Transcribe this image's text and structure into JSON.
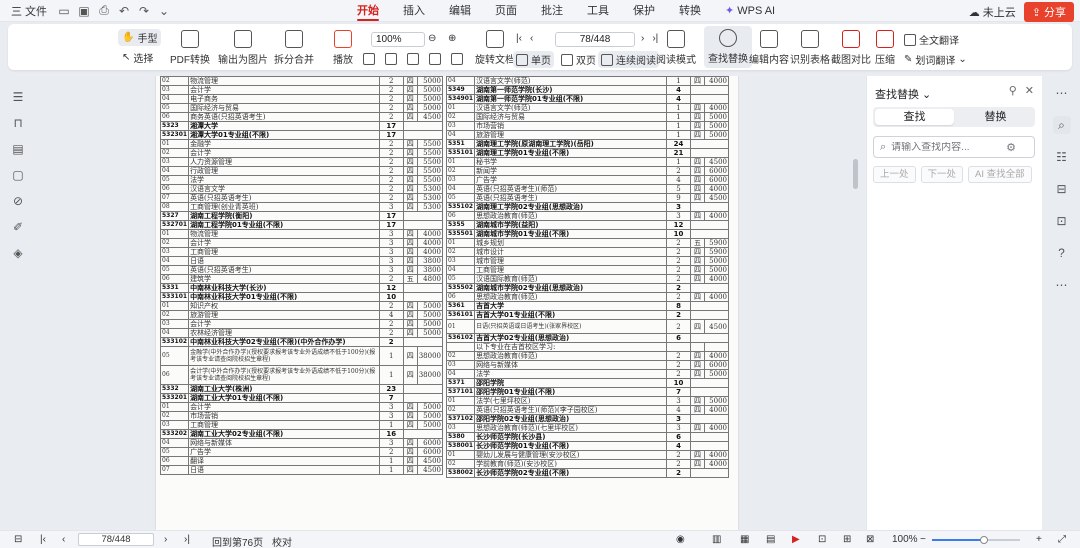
{
  "menubar": {
    "file_label": "三 文件",
    "tabs": [
      "开始",
      "插入",
      "编辑",
      "页面",
      "批注",
      "工具",
      "保护",
      "转换"
    ],
    "active_tab": "开始",
    "wps_ai": "WPS AI",
    "cloud": "未上云",
    "share": "分享"
  },
  "ribbon": {
    "hand": "手型",
    "select": "选择",
    "pdf_convert": "PDF转换",
    "export_image": "输出为图片",
    "split_merge": "拆分合并",
    "play": "播放",
    "zoom": "100%",
    "page": "78/448",
    "rotate": "旋转文档",
    "single": "单页",
    "double": "双页",
    "continuous": "连续阅读",
    "reading_mode": "阅读模式",
    "find_replace": "查找替换",
    "edit_content": "编辑内容",
    "recognize_table": "识别表格",
    "screenshot_compare": "截图对比",
    "compress": "压缩",
    "full_translate": "全文翻译",
    "word_translate": "划词翻译"
  },
  "panel": {
    "title": "查找替换",
    "tab_find": "查找",
    "tab_replace": "替换",
    "placeholder": "请输入查找内容...",
    "prev": "上一处",
    "next": "下一处",
    "ai_find": "AI 查找全部"
  },
  "status": {
    "page": "78/448",
    "goto": "回到第76页",
    "proofread": "校对",
    "zoom": "100%"
  },
  "doc": {
    "left": [
      {
        "c": "02",
        "n": "物流管理",
        "y": "2",
        "s": "四",
        "f": "5000"
      },
      {
        "c": "03",
        "n": "会计学",
        "y": "2",
        "s": "四",
        "f": "5000"
      },
      {
        "c": "04",
        "n": "电子商务",
        "y": "2",
        "s": "四",
        "f": "5000"
      },
      {
        "c": "05",
        "n": "国际经济与贸易",
        "y": "2",
        "s": "四",
        "f": "5000"
      },
      {
        "c": "06",
        "n": "商务英语(只招英语考生)",
        "y": "2",
        "s": "四",
        "f": "4500"
      },
      {
        "b": true,
        "c": "5323",
        "n": "湘潭大学",
        "y": "17"
      },
      {
        "b": true,
        "c": "532301",
        "n": "湘潭大学01专业组(不限)",
        "y": "17"
      },
      {
        "c": "01",
        "n": "金融学",
        "y": "2",
        "s": "四",
        "f": "5500"
      },
      {
        "c": "02",
        "n": "会计学",
        "y": "2",
        "s": "四",
        "f": "5500"
      },
      {
        "c": "03",
        "n": "人力资源管理",
        "y": "2",
        "s": "四",
        "f": "5500"
      },
      {
        "c": "04",
        "n": "行政管理",
        "y": "2",
        "s": "四",
        "f": "5500"
      },
      {
        "c": "05",
        "n": "法学",
        "y": "2",
        "s": "四",
        "f": "5500"
      },
      {
        "c": "06",
        "n": "汉语言文学",
        "y": "2",
        "s": "四",
        "f": "5300"
      },
      {
        "c": "07",
        "n": "英语(只招英语考生)",
        "y": "2",
        "s": "四",
        "f": "5300"
      },
      {
        "c": "08",
        "n": "工商管理(创业青英班)",
        "y": "3",
        "s": "四",
        "f": "5300"
      },
      {
        "b": true,
        "c": "5327",
        "n": "湖南工程学院(衡阳)",
        "y": "17"
      },
      {
        "b": true,
        "c": "532701",
        "n": "湖南工程学院01专业组(不限)",
        "y": "17"
      },
      {
        "c": "01",
        "n": "物流管理",
        "y": "3",
        "s": "四",
        "f": "4000"
      },
      {
        "c": "02",
        "n": "会计学",
        "y": "3",
        "s": "四",
        "f": "4000"
      },
      {
        "c": "03",
        "n": "工商管理",
        "y": "3",
        "s": "四",
        "f": "4000"
      },
      {
        "c": "04",
        "n": "日语",
        "y": "3",
        "s": "四",
        "f": "3800"
      },
      {
        "c": "05",
        "n": "英语(只招英语考生)",
        "y": "3",
        "s": "四",
        "f": "3800"
      },
      {
        "c": "06",
        "n": "建筑学",
        "y": "2",
        "s": "五",
        "f": "4800"
      },
      {
        "b": true,
        "c": "5331",
        "n": "中南林业科技大学(长沙)",
        "y": "12"
      },
      {
        "b": true,
        "c": "533101",
        "n": "中南林业科技大学01专业组(不限)",
        "y": "10"
      },
      {
        "c": "01",
        "n": "知识产权",
        "y": "2",
        "s": "四",
        "f": "5000"
      },
      {
        "c": "02",
        "n": "旅游管理",
        "y": "4",
        "s": "四",
        "f": "5000"
      },
      {
        "c": "03",
        "n": "会计学",
        "y": "2",
        "s": "四",
        "f": "5000"
      },
      {
        "c": "04",
        "n": "农林经济管理",
        "y": "2",
        "s": "四",
        "f": "5000"
      },
      {
        "b": true,
        "c": "533102",
        "n": "中南林业科技大学02专业组(不限)(中外合作办学)",
        "y": "2"
      },
      {
        "t": "tall",
        "c": "05",
        "n": "金融学(中外合作办学)(授权要求报考该专业外语成绩不低于100分)(报考该专业请查阅院校招生章程)",
        "y": "1",
        "s": "四",
        "f": "38000"
      },
      {
        "t": "tall",
        "c": "06",
        "n": "会计学(中外合作办学)(授权要求报考该专业外语成绩不低于100分)(报考该专业请查阅院校招生章程)",
        "y": "1",
        "s": "四",
        "f": "38000"
      },
      {
        "b": true,
        "c": "5332",
        "n": "湖南工业大学(株洲)",
        "y": "23"
      },
      {
        "b": true,
        "c": "533201",
        "n": "湖南工业大学01专业组(不限)",
        "y": "7"
      },
      {
        "c": "01",
        "n": "会计学",
        "y": "3",
        "s": "四",
        "f": "5000"
      },
      {
        "c": "02",
        "n": "市场营销",
        "y": "3",
        "s": "四",
        "f": "5000"
      },
      {
        "c": "03",
        "n": "工商管理",
        "y": "1",
        "s": "四",
        "f": "5000"
      },
      {
        "b": true,
        "c": "533202",
        "n": "湖南工业大学02专业组(不限)",
        "y": "16"
      },
      {
        "c": "04",
        "n": "网络与新媒体",
        "y": "3",
        "s": "四",
        "f": "6000"
      },
      {
        "c": "05",
        "n": "广告学",
        "y": "2",
        "s": "四",
        "f": "6000"
      },
      {
        "c": "06",
        "n": "翻译",
        "y": "1",
        "s": "四",
        "f": "4500"
      },
      {
        "c": "07",
        "n": "日语",
        "y": "1",
        "s": "四",
        "f": "4500"
      }
    ],
    "right": [
      {
        "c": "04",
        "n": "汉语言文学(师范)",
        "y": "1",
        "s": "四",
        "f": "4000"
      },
      {
        "b": true,
        "c": "5349",
        "n": "湖南第一师范学院(长沙)",
        "y": "4"
      },
      {
        "b": true,
        "c": "534901",
        "n": "湖南第一师范学院01专业组(不限)",
        "y": "4"
      },
      {
        "c": "01",
        "n": "汉语言文学(师范)",
        "y": "1",
        "s": "四",
        "f": "4000"
      },
      {
        "c": "02",
        "n": "国际经济与贸易",
        "y": "1",
        "s": "四",
        "f": "5000"
      },
      {
        "c": "03",
        "n": "市场营销",
        "y": "1",
        "s": "四",
        "f": "5000"
      },
      {
        "c": "04",
        "n": "旅游管理",
        "y": "1",
        "s": "四",
        "f": "5000"
      },
      {
        "b": true,
        "c": "5351",
        "n": "湖南理工学院(原湖南理工学院)(岳阳)",
        "y": "24"
      },
      {
        "b": true,
        "c": "535101",
        "n": "湖南理工学院01专业组(不限)",
        "y": "21"
      },
      {
        "c": "01",
        "n": "秘书学",
        "y": "1",
        "s": "四",
        "f": "4500"
      },
      {
        "c": "02",
        "n": "新闻学",
        "y": "2",
        "s": "四",
        "f": "6000"
      },
      {
        "c": "03",
        "n": "广告学",
        "y": "4",
        "s": "四",
        "f": "6000"
      },
      {
        "c": "04",
        "n": "英语(只招英语考生)(师范)",
        "y": "5",
        "s": "四",
        "f": "4000"
      },
      {
        "c": "05",
        "n": "英语(只招英语考生)",
        "y": "9",
        "s": "四",
        "f": "4500"
      },
      {
        "b": true,
        "c": "535102",
        "n": "湖南理工学院02专业组(思想政治)",
        "y": "3"
      },
      {
        "c": "06",
        "n": "思想政治教育(师范)",
        "y": "3",
        "s": "四",
        "f": "4000"
      },
      {
        "b": true,
        "c": "5355",
        "n": "湖南城市学院(益阳)",
        "y": "12"
      },
      {
        "b": true,
        "c": "535501",
        "n": "湖南城市学院01专业组(不限)",
        "y": "10"
      },
      {
        "c": "01",
        "n": "城乡规划",
        "y": "2",
        "s": "五",
        "f": "5900"
      },
      {
        "c": "02",
        "n": "城市设计",
        "y": "2",
        "s": "四",
        "f": "5900"
      },
      {
        "c": "03",
        "n": "城市管理",
        "y": "2",
        "s": "四",
        "f": "5000"
      },
      {
        "c": "04",
        "n": "工商管理",
        "y": "2",
        "s": "四",
        "f": "5000"
      },
      {
        "c": "05",
        "n": "汉语国际教育(师范)",
        "y": "2",
        "s": "四",
        "f": "4000"
      },
      {
        "b": true,
        "c": "535502",
        "n": "湖南城市学院02专业组(思想政治)",
        "y": "2"
      },
      {
        "c": "06",
        "n": "思想政治教育(师范)",
        "y": "2",
        "s": "四",
        "f": "4000"
      },
      {
        "b": true,
        "c": "5361",
        "n": "吉首大学",
        "y": "8"
      },
      {
        "b": true,
        "c": "536101",
        "n": "吉首大学01专业组(不限)",
        "y": "2"
      },
      {
        "t": "mid",
        "c": "01",
        "n": "日语(只招英语或日语考生)(张家界校区)",
        "y": "2",
        "s": "四",
        "f": "4500"
      },
      {
        "b": true,
        "c": "536102",
        "n": "吉首大学02专业组(思想政治)",
        "y": "6"
      },
      {
        "c": "",
        "n": "以下专业在吉首校区学习:",
        "y": "",
        "s": "",
        "f": ""
      },
      {
        "c": "02",
        "n": "思想政治教育(师范)",
        "y": "2",
        "s": "四",
        "f": "4000"
      },
      {
        "c": "03",
        "n": "网络与新媒体",
        "y": "2",
        "s": "四",
        "f": "6000"
      },
      {
        "c": "04",
        "n": "法学",
        "y": "2",
        "s": "四",
        "f": "5000"
      },
      {
        "b": true,
        "c": "5371",
        "n": "邵阳学院",
        "y": "10"
      },
      {
        "b": true,
        "c": "537101",
        "n": "邵阳学院01专业组(不限)",
        "y": "7"
      },
      {
        "c": "01",
        "n": "法学(七里坪校区)",
        "y": "3",
        "s": "四",
        "f": "5000"
      },
      {
        "c": "02",
        "n": "英语(只招英语考生)(师范)(李子园校区)",
        "y": "4",
        "s": "四",
        "f": "4000"
      },
      {
        "b": true,
        "c": "537102",
        "n": "邵阳学院02专业组(思想政治)",
        "y": "3"
      },
      {
        "c": "03",
        "n": "思想政治教育(师范)(七里坪校区)",
        "y": "3",
        "s": "四",
        "f": "4000"
      },
      {
        "b": true,
        "c": "5380",
        "n": "长沙师范学院(长沙县)",
        "y": "6"
      },
      {
        "b": true,
        "c": "538001",
        "n": "长沙师范学院01专业组(不限)",
        "y": "4"
      },
      {
        "c": "01",
        "n": "婴幼儿发展与健康管理(安沙校区)",
        "y": "2",
        "s": "四",
        "f": "4000"
      },
      {
        "c": "02",
        "n": "学前教育(师范)(安沙校区)",
        "y": "2",
        "s": "四",
        "f": "4000"
      },
      {
        "b": true,
        "c": "538002",
        "n": "长沙师范学院02专业组(不限)",
        "y": "2"
      }
    ]
  }
}
